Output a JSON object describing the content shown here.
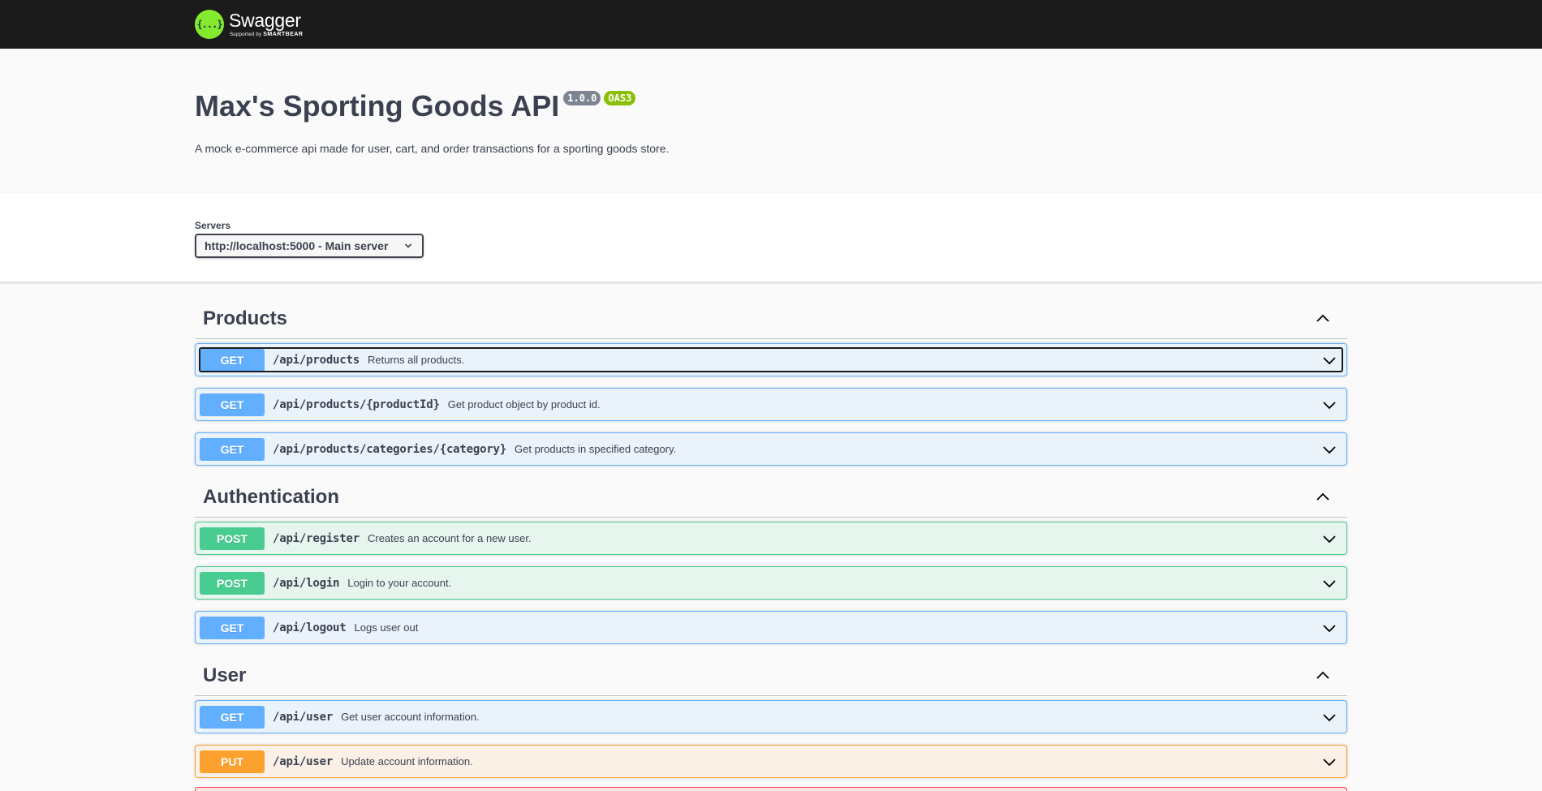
{
  "topbar": {
    "logo_glyph": "{...}",
    "logo_name": "Swagger",
    "logo_sub_prefix": "Supported by",
    "logo_sub_brand": "SMARTBEAR"
  },
  "info": {
    "title": "Max's Sporting Goods API",
    "version": "1.0.0",
    "oas": "OAS3",
    "description": "A mock e-commerce api made for user, cart, and order transactions for a sporting goods store."
  },
  "servers": {
    "label": "Servers",
    "selected": "http://localhost:5000 - Main server"
  },
  "tags": [
    {
      "name": "Products",
      "operations": [
        {
          "method": "GET",
          "path": "/api/products",
          "summary": "Returns all products."
        },
        {
          "method": "GET",
          "path": "/api/products/{productId}",
          "summary": "Get product object by product id."
        },
        {
          "method": "GET",
          "path": "/api/products/categories/{category}",
          "summary": "Get products in specified category."
        }
      ]
    },
    {
      "name": "Authentication",
      "operations": [
        {
          "method": "POST",
          "path": "/api/register",
          "summary": "Creates an account for a new user."
        },
        {
          "method": "POST",
          "path": "/api/login",
          "summary": "Login to your account."
        },
        {
          "method": "GET",
          "path": "/api/logout",
          "summary": "Logs user out"
        }
      ]
    },
    {
      "name": "User",
      "operations": [
        {
          "method": "GET",
          "path": "/api/user",
          "summary": "Get user account information."
        },
        {
          "method": "PUT",
          "path": "/api/user",
          "summary": "Update account information."
        }
      ]
    }
  ],
  "colors": {
    "get": "#61afe",
    "post": "#49cc90",
    "put": "#fca130",
    "delete": "#f93e3e",
    "topbar": "#1b1b1b",
    "logo_green": "#85ea2d"
  },
  "icons": {
    "tag_toggle": "chevron-up-icon",
    "op_toggle": "chevron-down-icon",
    "server_dropdown": "chevron-down-icon"
  }
}
